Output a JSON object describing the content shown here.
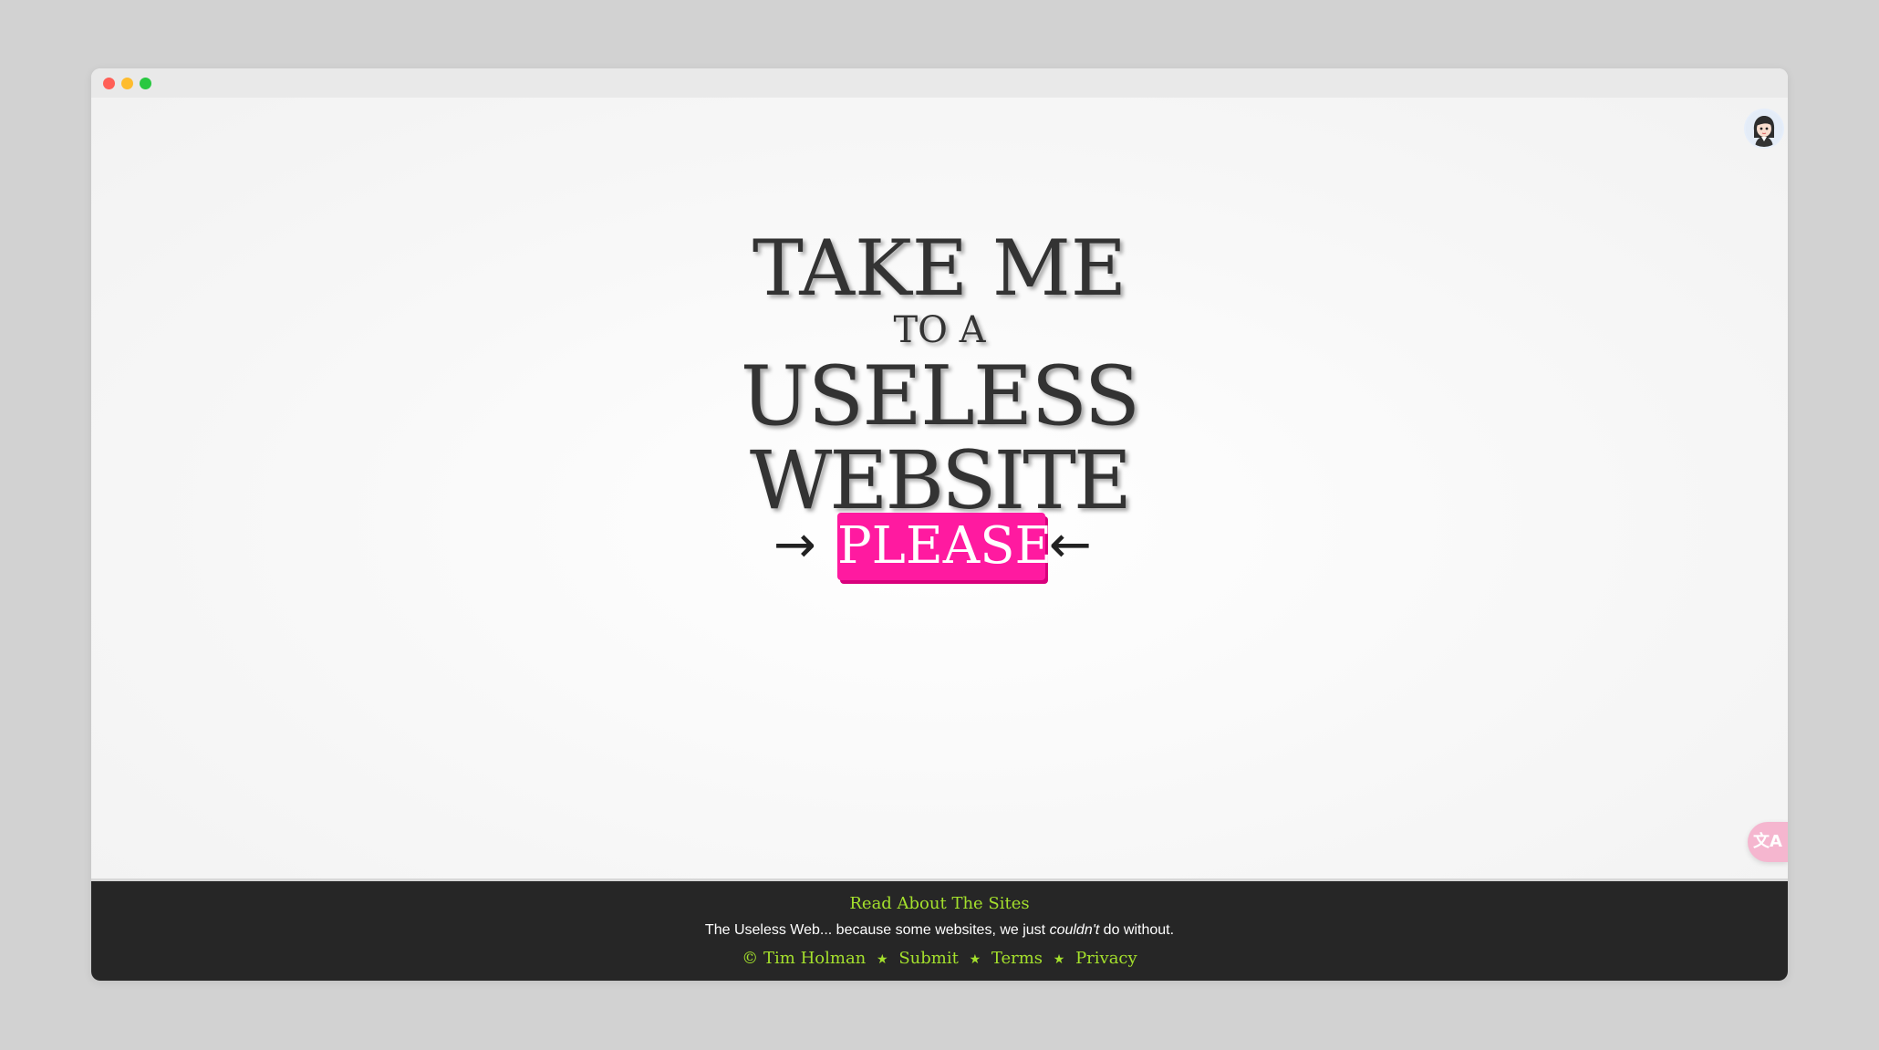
{
  "window": {
    "controls": [
      "close",
      "minimize",
      "maximize"
    ]
  },
  "header": {
    "avatar_icon": "user-avatar-icon"
  },
  "hero": {
    "line1": "TAKE ME",
    "line2": "TO A",
    "line3": "USELESS",
    "line4": "WEBSITE",
    "left_arrow": "→",
    "button_label": "PLEASE",
    "right_arrow": "←",
    "button_color": "#ff1aa0"
  },
  "side_tool": {
    "translate_label": "文A",
    "color": "#f5b6cf"
  },
  "footer": {
    "read_link": "Read About The Sites",
    "tagline_start": "The Useless Web... because some websites, we just ",
    "tagline_emphasis": "couldn't",
    "tagline_end": " do without.",
    "copyright_symbol": "©",
    "author_link": "Tim Holman",
    "separator": "★",
    "submit_link": "Submit",
    "terms_link": "Terms",
    "privacy_link": "Privacy",
    "link_color": "#a4e02c",
    "background": "#262626"
  }
}
